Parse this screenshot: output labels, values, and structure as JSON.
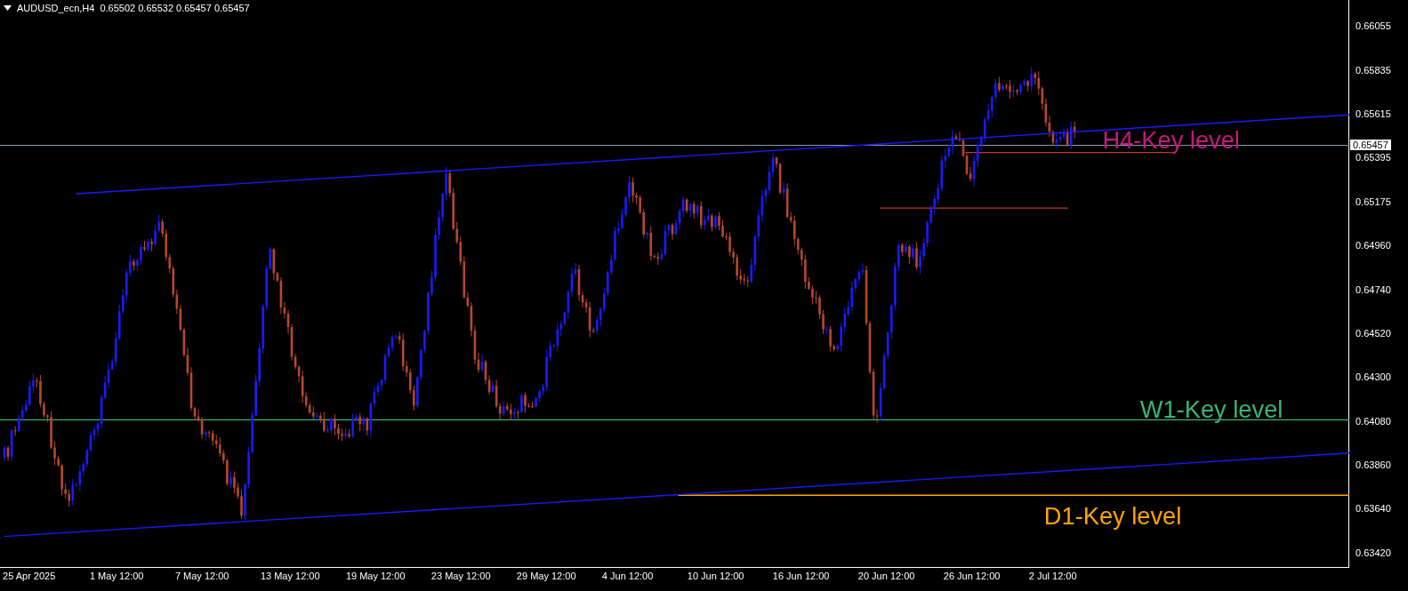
{
  "header": {
    "symbol": "AUDUSD_ecn,H4",
    "quote": "0.65502 0.65532 0.65457 0.65457"
  },
  "price_axis": {
    "ticks": [
      "0.66055",
      "0.65835",
      "0.65615",
      "0.65395",
      "0.65175",
      "0.64960",
      "0.64740",
      "0.64520",
      "0.64300",
      "0.64080",
      "0.63860",
      "0.63640",
      "0.63420"
    ],
    "current_price": "0.65457"
  },
  "time_axis": [
    "25 Apr 2025",
    "1 May 12:00",
    "7 May 12:00",
    "13 May 12:00",
    "19 May 12:00",
    "23 May 12:00",
    "29 May 12:00",
    "4 Jun 12:00",
    "10 Jun 12:00",
    "16 Jun 12:00",
    "20 Jun 12:00",
    "26 Jun 12:00",
    "2 Jul 12:00"
  ],
  "levels": [
    {
      "label": "H4-Key level",
      "color": "#c8177e"
    },
    {
      "label": "W1-Key level",
      "color": "#3cb371"
    },
    {
      "label": "D1-Key level",
      "color": "#ffa500"
    }
  ]
}
